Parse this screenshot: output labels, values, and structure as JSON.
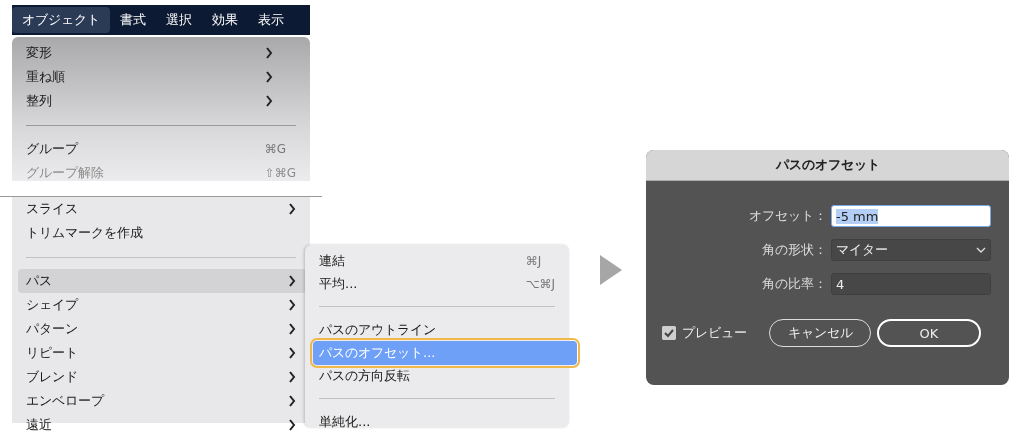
{
  "menubar": [
    {
      "label": "オブジェクト",
      "selected": true
    },
    {
      "label": "書式",
      "selected": false
    },
    {
      "label": "選択",
      "selected": false
    },
    {
      "label": "効果",
      "selected": false
    },
    {
      "label": "表示",
      "selected": false
    }
  ],
  "menu_top": [
    {
      "kind": "submenu",
      "label": "変形",
      "disabled": false
    },
    {
      "kind": "submenu",
      "label": "重ね順",
      "disabled": false
    },
    {
      "kind": "submenu",
      "label": "整列",
      "disabled": false
    },
    {
      "kind": "separator"
    },
    {
      "kind": "item",
      "label": "グループ",
      "shortcut": "⌘G",
      "disabled": false
    },
    {
      "kind": "item",
      "label": "グループ解除",
      "shortcut": "⇧⌘G",
      "disabled": true
    }
  ],
  "menu_bottom": [
    {
      "kind": "submenu",
      "label": "スライス",
      "selected": false
    },
    {
      "kind": "item",
      "label": "トリムマークを作成",
      "selected": false
    },
    {
      "kind": "separator"
    },
    {
      "kind": "submenu",
      "label": "パス",
      "selected": true
    },
    {
      "kind": "submenu",
      "label": "シェイプ",
      "selected": false
    },
    {
      "kind": "submenu",
      "label": "パターン",
      "selected": false
    },
    {
      "kind": "submenu",
      "label": "リピート",
      "selected": false
    },
    {
      "kind": "submenu",
      "label": "ブレンド",
      "selected": false
    },
    {
      "kind": "submenu",
      "label": "エンベロープ",
      "selected": false
    },
    {
      "kind": "submenu",
      "label": "遠近",
      "selected": false
    }
  ],
  "submenu": [
    {
      "kind": "item",
      "label": "連結",
      "shortcut": "⌘J",
      "selected": false
    },
    {
      "kind": "item",
      "label": "平均...",
      "shortcut": "⌥⌘J",
      "selected": false
    },
    {
      "kind": "separator"
    },
    {
      "kind": "item",
      "label": "パスのアウトライン",
      "selected": false
    },
    {
      "kind": "item",
      "label": "パスのオフセット...",
      "selected": true
    },
    {
      "kind": "item",
      "label": "パスの方向反転",
      "selected": false
    },
    {
      "kind": "separator"
    },
    {
      "kind": "item",
      "label": "単純化...",
      "selected": false
    }
  ],
  "dialog": {
    "title": "パスのオフセット",
    "fields": [
      {
        "kind": "text",
        "label": "オフセット：",
        "value": "-5 mm",
        "focused": true
      },
      {
        "kind": "select",
        "label": "角の形状：",
        "value": "マイター",
        "focused": false
      },
      {
        "kind": "text",
        "label": "角の比率：",
        "value": "4",
        "focused": false
      }
    ],
    "preview": {
      "label": "プレビュー",
      "checked": true
    },
    "buttons": [
      {
        "label": "キャンセル",
        "default": false
      },
      {
        "label": "OK",
        "default": true
      }
    ]
  }
}
